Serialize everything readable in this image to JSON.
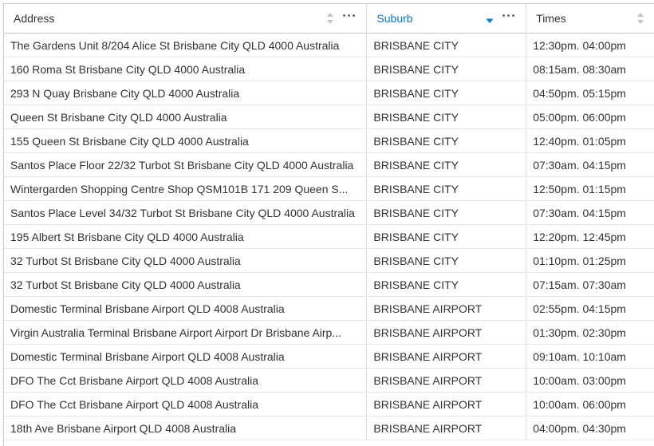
{
  "columns": [
    {
      "key": "address",
      "label": "Address",
      "sort": "none",
      "has_menu": true
    },
    {
      "key": "suburb",
      "label": "Suburb",
      "sort": "descending",
      "has_menu": true
    },
    {
      "key": "times",
      "label": "Times",
      "sort": "none",
      "has_menu": false
    }
  ],
  "accent_color": "#007ac2",
  "rows": [
    {
      "address": "The Gardens Unit 8/204 Alice St Brisbane City QLD 4000 Australia",
      "suburb": "BRISBANE CITY",
      "times": "12:30pm. 04:00pm"
    },
    {
      "address": "160 Roma St Brisbane City QLD 4000 Australia",
      "suburb": "BRISBANE CITY",
      "times": "08:15am. 08:30am"
    },
    {
      "address": "293 N Quay Brisbane City QLD 4000 Australia",
      "suburb": "BRISBANE CITY",
      "times": "04:50pm. 05:15pm"
    },
    {
      "address": "Queen St Brisbane City QLD 4000 Australia",
      "suburb": "BRISBANE CITY",
      "times": "05:00pm. 06:00pm"
    },
    {
      "address": "155 Queen St Brisbane City QLD 4000 Australia",
      "suburb": "BRISBANE CITY",
      "times": "12:40pm. 01:05pm"
    },
    {
      "address": "Santos Place Floor 22/32 Turbot St Brisbane City QLD 4000 Australia",
      "suburb": "BRISBANE CITY",
      "times": "07:30am. 04:15pm"
    },
    {
      "address": "Wintergarden Shopping Centre Shop QSM101B 171 209 Queen S...",
      "suburb": "BRISBANE CITY",
      "times": "12:50pm. 01:15pm"
    },
    {
      "address": "Santos Place Level 34/32 Turbot St Brisbane City QLD 4000 Australia",
      "suburb": "BRISBANE CITY",
      "times": "07:30am. 04:15pm"
    },
    {
      "address": "195 Albert St Brisbane City QLD 4000 Australia",
      "suburb": "BRISBANE CITY",
      "times": "12:20pm. 12:45pm"
    },
    {
      "address": "32 Turbot St Brisbane City QLD 4000 Australia",
      "suburb": "BRISBANE CITY",
      "times": "01:10pm. 01:25pm"
    },
    {
      "address": "32 Turbot St Brisbane City QLD 4000 Australia",
      "suburb": "BRISBANE CITY",
      "times": "07:15am. 07:30am"
    },
    {
      "address": "Domestic Terminal Brisbane Airport QLD 4008 Australia",
      "suburb": "BRISBANE AIRPORT",
      "times": "02:55pm. 04:15pm"
    },
    {
      "address": "Virgin Australia Terminal Brisbane Airport Airport Dr Brisbane Airp...",
      "suburb": "BRISBANE AIRPORT",
      "times": "01:30pm. 02:30pm"
    },
    {
      "address": "Domestic Terminal Brisbane Airport QLD 4008 Australia",
      "suburb": "BRISBANE AIRPORT",
      "times": "09:10am. 10:10am"
    },
    {
      "address": "DFO The Cct Brisbane Airport QLD 4008 Australia",
      "suburb": "BRISBANE AIRPORT",
      "times": "10:00am. 03:00pm"
    },
    {
      "address": "DFO The Cct Brisbane Airport QLD 4008 Australia",
      "suburb": "BRISBANE AIRPORT",
      "times": "10:00am. 06:00pm"
    },
    {
      "address": "18th Ave Brisbane Airport QLD 4008 Australia",
      "suburb": "BRISBANE AIRPORT",
      "times": "04:00pm. 04:30pm"
    }
  ]
}
